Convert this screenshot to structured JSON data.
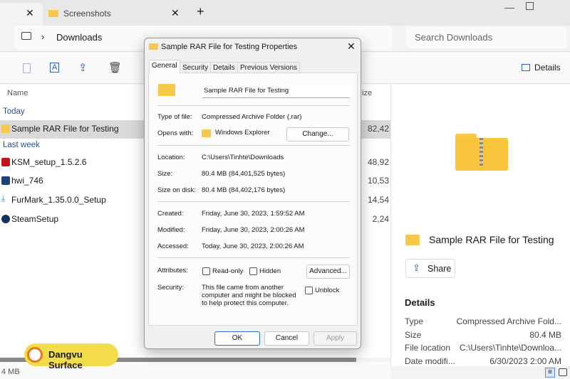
{
  "tabs": [
    {
      "label": "Screenshots"
    }
  ],
  "address": {
    "location": "Downloads"
  },
  "search": {
    "placeholder": "Search Downloads"
  },
  "toolbar": {
    "details_label": "Details"
  },
  "list": {
    "column_name": "Name",
    "column_size": "ize",
    "groups": [
      {
        "label": "Today",
        "items": [
          {
            "name": "Sample RAR File for Testing",
            "size": "82,42",
            "icon": "rar-archive-icon",
            "selected": true
          }
        ]
      },
      {
        "label": "Last week",
        "items": [
          {
            "name": "KSM_setup_1.5.2.6",
            "size": "48,92",
            "icon": "ksm-installer-icon"
          },
          {
            "name": "hwi_746",
            "size": "10,53",
            "icon": "hwinfo-icon"
          },
          {
            "name": "FurMark_1.35.0.0_Setup",
            "size": "14,54",
            "icon": "installer-icon"
          },
          {
            "name": "SteamSetup",
            "size": "2,24",
            "icon": "steam-icon"
          }
        ]
      }
    ]
  },
  "status": {
    "size": "4 MB"
  },
  "watermark": {
    "brand": "Dangvu Surface"
  },
  "dialog": {
    "title": "Sample RAR File for Testing Properties",
    "tabs": [
      "General",
      "Security",
      "Details",
      "Previous Versions"
    ],
    "active_tab": "General",
    "filename": "Sample RAR File for Testing",
    "type_label": "Type of file:",
    "type_value": "Compressed Archive Folder (.rar)",
    "opens_label": "Opens with:",
    "opens_value": "Windows Explorer",
    "change_button": "Change...",
    "location_label": "Location:",
    "location_value": "C:\\Users\\Tinhte\\Downloads",
    "size_label": "Size:",
    "size_value": "80.4 MB (84,401,525 bytes)",
    "disk_label": "Size on disk:",
    "disk_value": "80.4 MB (84,402,176 bytes)",
    "created_label": "Created:",
    "created_value": "Friday, June 30, 2023, 1:59:52 AM",
    "modified_label": "Modified:",
    "modified_value": "Friday, June 30, 2023, 2:00:26 AM",
    "accessed_label": "Accessed:",
    "accessed_value": "Today, June 30, 2023, 2:00:26 AM",
    "attributes_label": "Attributes:",
    "readonly_label": "Read-only",
    "hidden_label": "Hidden",
    "advanced_button": "Advanced...",
    "security_label": "Security:",
    "security_text": "This file came from another computer and might be blocked to help protect this computer.",
    "unblock_label": "Unblock",
    "ok": "OK",
    "cancel": "Cancel",
    "apply": "Apply"
  },
  "details_pane": {
    "name": "Sample RAR File for Testing",
    "share": "Share",
    "heading": "Details",
    "rows": [
      {
        "label": "Type",
        "value": "Compressed Archive Fold..."
      },
      {
        "label": "Size",
        "value": "80.4 MB"
      },
      {
        "label": "File location",
        "value": "C:\\Users\\Tinhte\\Downloa..."
      },
      {
        "label": "Date modifi...",
        "value": "6/30/2023 2:00 AM"
      }
    ]
  }
}
